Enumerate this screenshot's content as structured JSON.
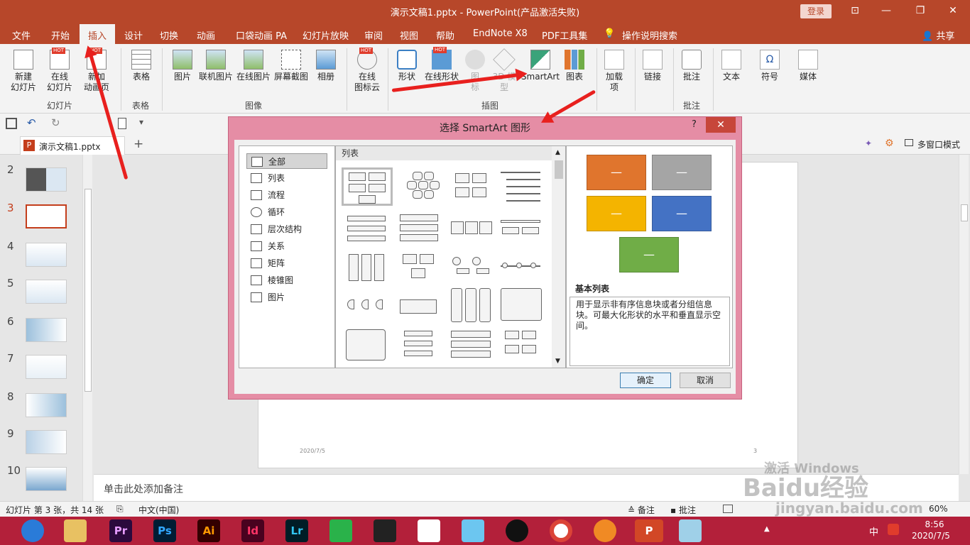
{
  "window": {
    "title": "演示文稿1.pptx  -  PowerPoint(产品激活失败)",
    "login": "登录",
    "min": "—",
    "restore": "❐",
    "close": "✕",
    "ribbon_opt": "⊡"
  },
  "tabs": [
    "文件",
    "开始",
    "插入",
    "设计",
    "切换",
    "动画",
    "口袋动画 PA",
    "幻灯片放映",
    "审阅",
    "视图",
    "帮助",
    "EndNote X8",
    "PDF工具集",
    "操作说明搜索"
  ],
  "share": "共享",
  "ribbon": {
    "new_slide": "新建\n幻灯片",
    "online_slide": "在线\n幻灯片",
    "new_anim": "新加\n动画页",
    "group_slides": "幻灯片",
    "table": "表格",
    "group_table": "表格",
    "picture": "图片",
    "linked_pic": "联机图片",
    "online_pic": "在线图片",
    "screenshot": "屏幕截图",
    "album": "相册",
    "group_image": "图像",
    "online_icon": "在线\n图标云",
    "shapes": "形状",
    "online_shapes": "在线形状",
    "icons": "图\n标",
    "models": "3D 模\n型",
    "smartart": "SmartArt",
    "chart": "图表",
    "group_illus": "插图",
    "addin": "加载\n项",
    "link": "链接",
    "comment": "批注",
    "group_comment": "批注",
    "text": "文本",
    "symbol": "符号",
    "media": "媒体",
    "hot": "HOT"
  },
  "doc_tab": "演示文稿1.pptx",
  "multiwindow": "多窗口模式",
  "thumbs": [
    "2",
    "3",
    "4",
    "5",
    "6",
    "7",
    "8",
    "9",
    "10"
  ],
  "slide": {
    "date": "2020/7/5",
    "page": "3"
  },
  "notes_placeholder": "单击此处添加备注",
  "status": {
    "slide_info": "幻灯片 第 3 张，共 14 张",
    "lang": "中文(中国)",
    "notes": "备注",
    "comments": "批注",
    "zoom": "60%"
  },
  "dialog": {
    "title": "选择 SmartArt 图形",
    "help": "?",
    "close": "✕",
    "categories": [
      "全部",
      "列表",
      "流程",
      "循环",
      "层次结构",
      "关系",
      "矩阵",
      "棱锥图",
      "图片"
    ],
    "gallery_header": "列表",
    "preview_name": "基本列表",
    "preview_desc": "用于显示非有序信息块或者分组信息块。可最大化形状的水平和垂直显示空间。",
    "ok": "确定",
    "cancel": "取消",
    "dash": "—",
    "colors": [
      "#e0752d",
      "#a5a5a5",
      "#f4b400",
      "#4472c4",
      "#70ad47"
    ]
  },
  "taskbar": {
    "apps": [
      "Pr",
      "Ps",
      "Ai",
      "Id",
      "Lr"
    ],
    "time": "8:56",
    "date": "2020/7/5",
    "input": "中"
  },
  "watermark": {
    "line1": "激活 Windows",
    "line2": "Baidu经验",
    "url": "jingyan.baidu.com"
  }
}
